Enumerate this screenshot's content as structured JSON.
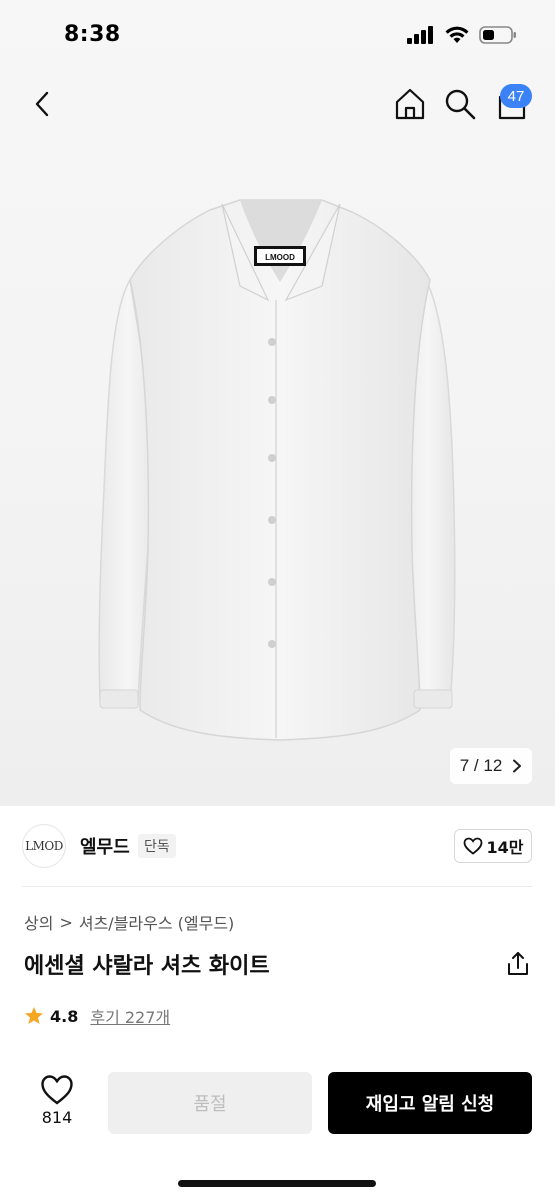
{
  "status_bar": {
    "time": "8:38"
  },
  "nav": {
    "cart_count": "47"
  },
  "product_image": {
    "label_text": "LMOOD",
    "counter_current": "7",
    "counter_sep": "/",
    "counter_total": "12"
  },
  "brand": {
    "logo_text": "LMOD",
    "name": "엘무드",
    "tag": "단독",
    "likes": "14만"
  },
  "breadcrumb": {
    "level1": "상의",
    "separator": ">",
    "level2": "셔츠/블라우스 (엘무드)"
  },
  "product": {
    "title": "에센셜 샤랄라 셔츠 화이트"
  },
  "rating": {
    "value": "4.8",
    "review_label": "후기 227개"
  },
  "bottom_bar": {
    "wish_count": "814",
    "soldout_label": "품절",
    "restock_label": "재입고 알림 신청"
  },
  "colors": {
    "accent_blue": "#3b82f6",
    "rating_star": "#f5a623",
    "primary_button": "#000000",
    "disabled_button": "#efefef"
  },
  "icons": [
    "back-icon",
    "home-icon",
    "search-icon",
    "cart-icon",
    "chevron-right-icon",
    "heart-icon",
    "share-icon",
    "star-icon",
    "signal-icon",
    "wifi-icon",
    "battery-icon"
  ]
}
